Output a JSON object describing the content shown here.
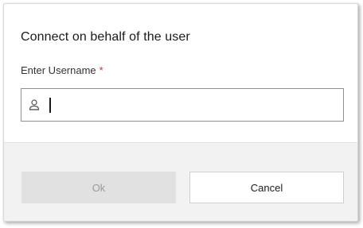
{
  "dialog": {
    "title": "Connect on behalf of the user",
    "username_label": "Enter Username",
    "required_marker": "*",
    "username_value": "",
    "ok_label": "Ok",
    "cancel_label": "Cancel"
  },
  "icons": {
    "input_icon": "user-icon"
  },
  "colors": {
    "required": "#d32f2f",
    "footer_bg": "#f2f2f2",
    "ok_button_bg": "#e1e1e1",
    "ok_button_text": "#9a9a9a"
  }
}
